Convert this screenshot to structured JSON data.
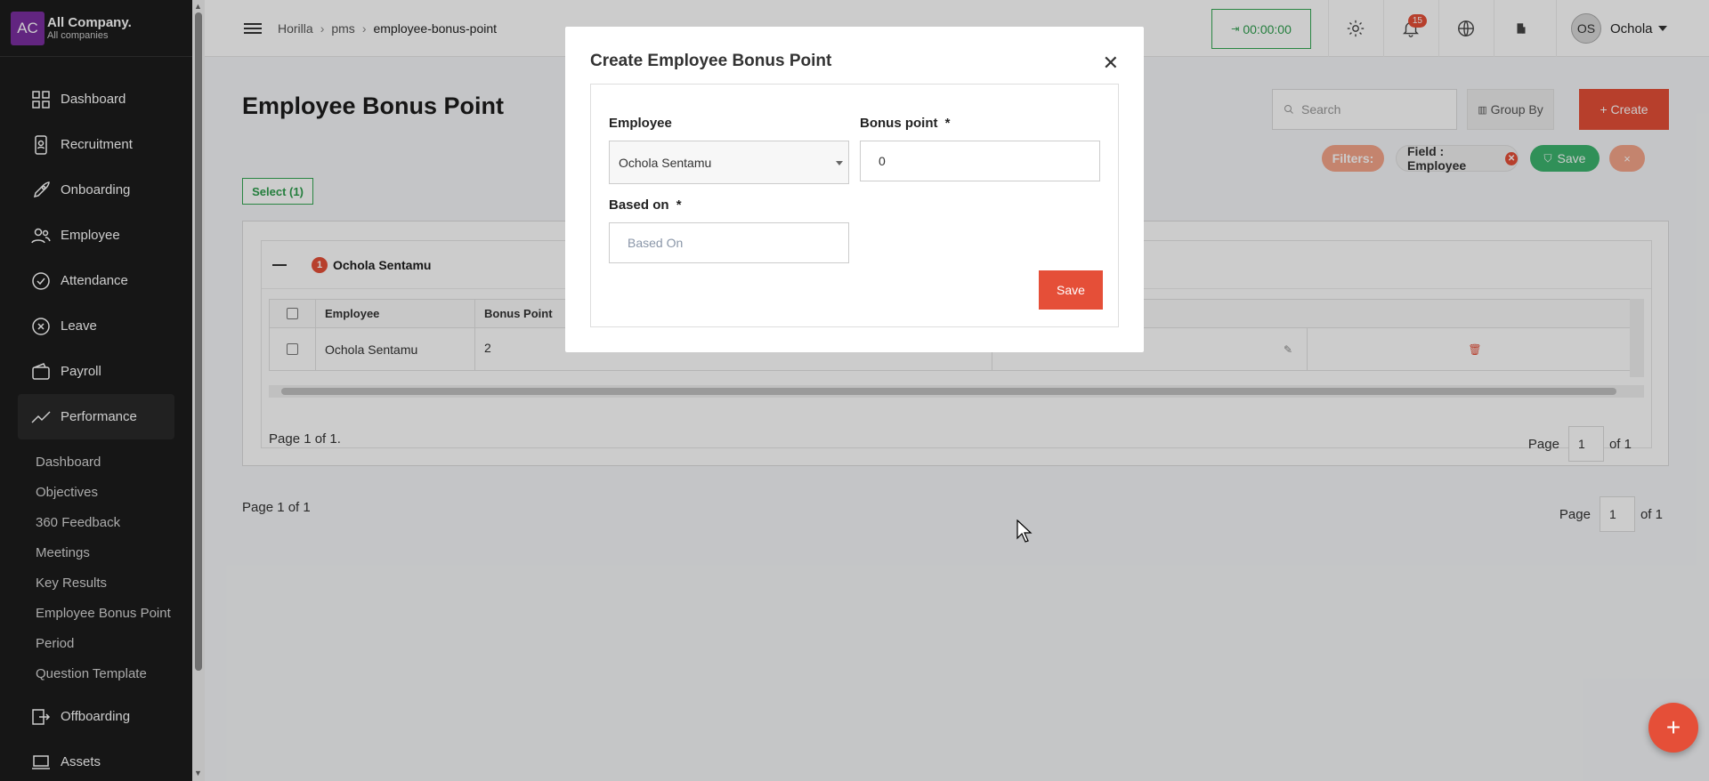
{
  "company": {
    "logo": "AC",
    "name": "All Company.",
    "sub": "All companies"
  },
  "sidebar": {
    "items": [
      {
        "label": "Dashboard",
        "icon": "dashboard-icon"
      },
      {
        "label": "Recruitment",
        "icon": "recruitment-icon"
      },
      {
        "label": "Onboarding",
        "icon": "rocket-icon"
      },
      {
        "label": "Employee",
        "icon": "people-icon"
      },
      {
        "label": "Attendance",
        "icon": "check-circle-icon"
      },
      {
        "label": "Leave",
        "icon": "x-circle-icon"
      },
      {
        "label": "Payroll",
        "icon": "wallet-icon"
      },
      {
        "label": "Performance",
        "icon": "trend-icon"
      }
    ],
    "subitems": [
      "Dashboard",
      "Objectives",
      "360 Feedback",
      "Meetings",
      "Key Results",
      "Employee Bonus Point",
      "Period",
      "Question Template"
    ],
    "after": [
      {
        "label": "Offboarding",
        "icon": "exit-icon"
      },
      {
        "label": "Assets",
        "icon": "laptop-icon"
      }
    ]
  },
  "header": {
    "crumbs": [
      "Horilla",
      "pms",
      "employee-bonus-point"
    ],
    "timer": "00:00:00",
    "notifications": "15",
    "user_initials": "OS",
    "user_name": "Ochola"
  },
  "main": {
    "title": "Employee Bonus Point",
    "search_placeholder": "Search",
    "group_by": "Group By",
    "create": "+ Create",
    "filters_label": "Filters:",
    "filter_chip": "Field : Employee",
    "filter_save": "Save",
    "filter_close": "×",
    "select_btn": "Select (1)",
    "group_name": "Ochola Sentamu",
    "group_count": "1",
    "columns": [
      "Employee",
      "Bonus Point"
    ],
    "rows": [
      {
        "employee": "Ochola Sentamu",
        "bonus": "2"
      }
    ],
    "inner_page": "Page 1 of 1.",
    "page_label": "Page",
    "page_num": "1",
    "page_of": "of 1",
    "outer_page": "Page 1 of 1"
  },
  "modal": {
    "title": "Create Employee Bonus Point",
    "employee_label": "Employee",
    "employee_value": "Ochola Sentamu",
    "bonus_label": "Bonus point",
    "bonus_value": "0",
    "based_label": "Based on",
    "based_placeholder": "Based On",
    "required": "*",
    "save": "Save"
  },
  "colors": {
    "accent": "#e54f38",
    "sidebar": "#1c1c1c",
    "green": "#34a853"
  }
}
